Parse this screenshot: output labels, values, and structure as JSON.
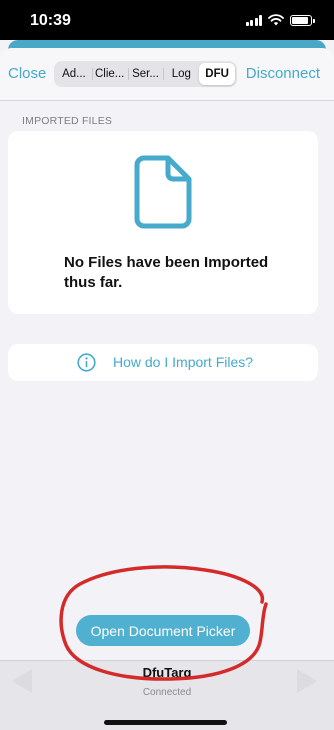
{
  "status_bar": {
    "time": "10:39"
  },
  "header": {
    "close_label": "Close",
    "disconnect_label": "Disconnect",
    "tabs": [
      {
        "label": "Ad...",
        "active": false
      },
      {
        "label": "Clie...",
        "active": false
      },
      {
        "label": "Ser...",
        "active": false
      },
      {
        "label": "Log",
        "active": false
      },
      {
        "label": "DFU",
        "active": true
      }
    ]
  },
  "imported_files": {
    "section_title": "IMPORTED FILES",
    "icon": "document-icon",
    "empty_message": "No Files have been Imported thus far."
  },
  "help": {
    "icon": "info-icon",
    "label": "How do I Import Files?"
  },
  "picker_button": {
    "label": "Open Document Picker"
  },
  "device": {
    "name": "DfuTarg",
    "status": "Connected"
  },
  "colors": {
    "accent": "#45aacb",
    "annotation": "#d42a2a"
  }
}
